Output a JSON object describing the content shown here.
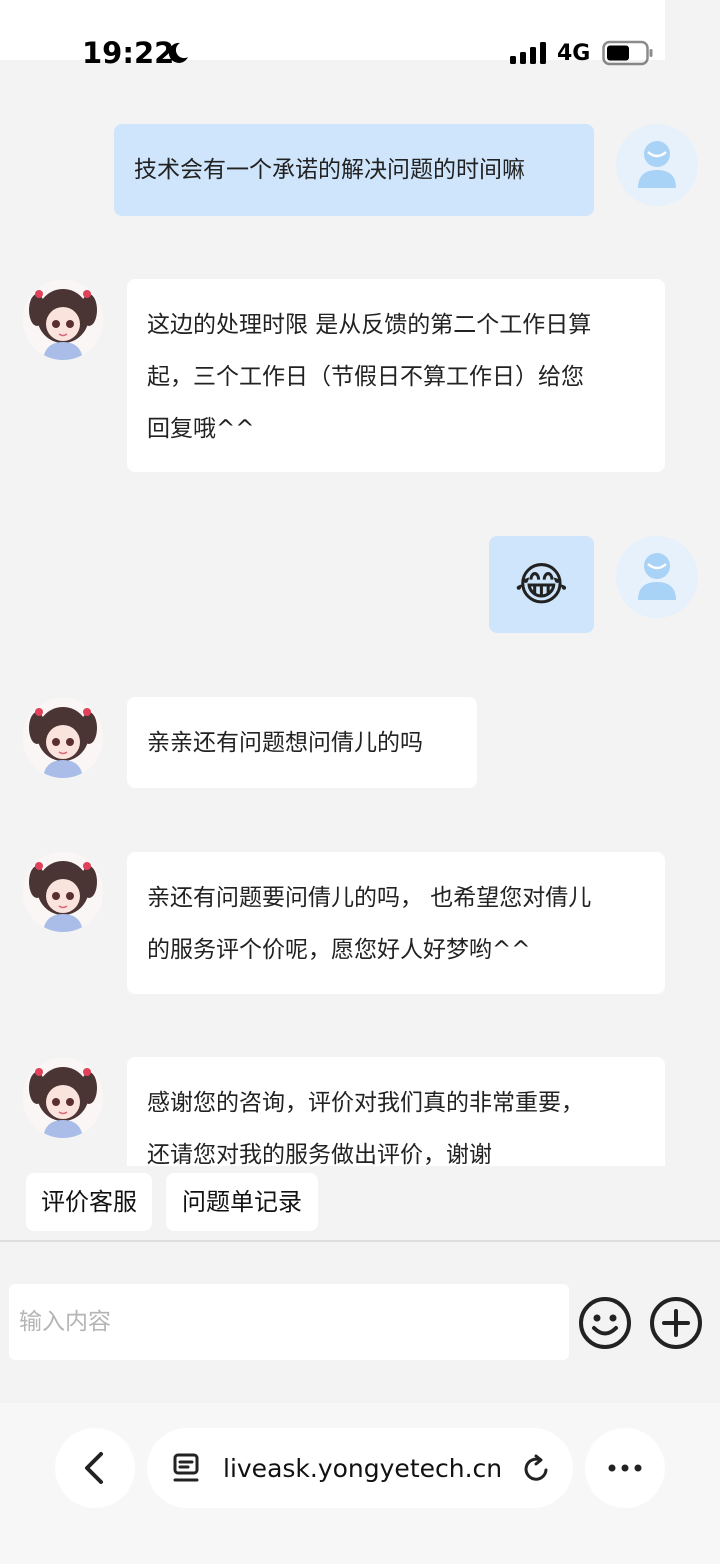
{
  "status_bar": {
    "time": "19:22",
    "network": "4G"
  },
  "chat": {
    "messages": [
      {
        "from": "user",
        "text": "技术会有一个承诺的解决问题的时间嘛"
      },
      {
        "from": "agent",
        "lines": [
          "这边的处理时限 是从反馈的第二个工作日算",
          "起，三个工作日（节假日不算工作日）给您",
          "回复哦^^"
        ]
      },
      {
        "from": "user",
        "emoji": "😂"
      },
      {
        "from": "agent",
        "text": "亲亲还有问题想问倩儿的吗"
      },
      {
        "from": "agent",
        "lines": [
          "亲还有问题要问倩儿的吗， 也希望您对倩儿",
          "的服务评个价呢，愿您好人好梦哟^^"
        ]
      },
      {
        "from": "agent",
        "lines": [
          "感谢您的咨询，评价对我们真的非常重要，",
          "还请您对我的服务做出评价，谢谢"
        ]
      }
    ]
  },
  "quick_actions": [
    "评价客服",
    "问题单记录"
  ],
  "composer": {
    "placeholder": "输入内容"
  },
  "browser": {
    "url": "liveask.yongyetech.cn"
  },
  "colors": {
    "user_bubble": "#cfe5fb",
    "agent_bubble": "#ffffff",
    "background": "#f3f3f3"
  }
}
